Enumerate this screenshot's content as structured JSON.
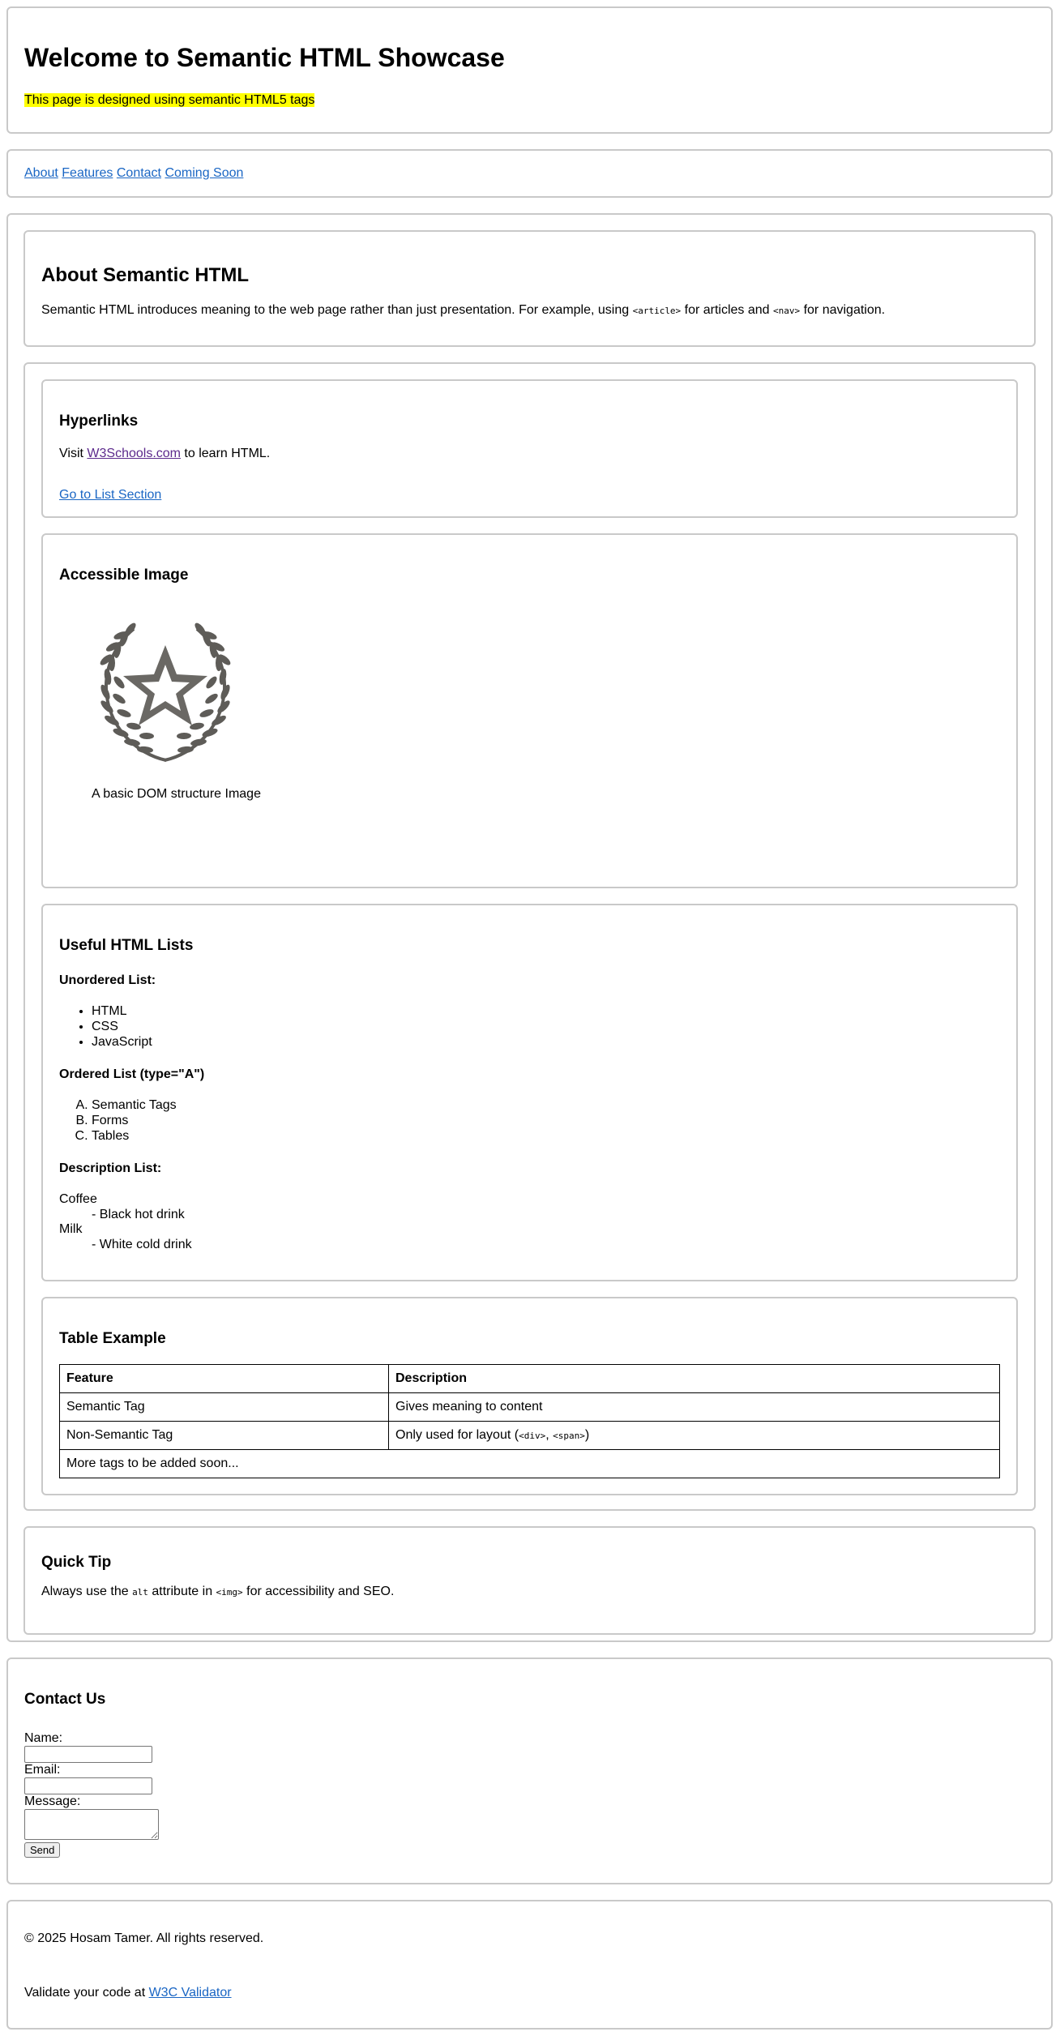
{
  "header": {
    "title": "Welcome to Semantic HTML Showcase",
    "tagline": "This page is designed using semantic HTML5 tags"
  },
  "nav": {
    "links": [
      "About",
      "Features",
      "Contact",
      "Coming Soon"
    ]
  },
  "about": {
    "heading": "About Semantic HTML",
    "text_1": "Semantic HTML introduces meaning to the web page rather than just presentation. For example, using ",
    "code_1": "<article>",
    "text_2": " for articles and ",
    "code_2": "<nav>",
    "text_3": " for navigation."
  },
  "hyperlinks": {
    "heading": "Hyperlinks",
    "visit_prefix": "Visit ",
    "link_text": "W3Schools.com",
    "visit_suffix": " to learn HTML.",
    "goto_text": "Go to List Section"
  },
  "image_section": {
    "heading": "Accessible Image",
    "icon": "laurel-star-icon",
    "caption": "A basic DOM structure Image"
  },
  "lists": {
    "heading": "Useful HTML Lists",
    "unordered_label": "Unordered List:",
    "unordered_items": [
      "HTML",
      "CSS",
      "JavaScript"
    ],
    "ordered_label": "Ordered List (type=\"A\")",
    "ordered_items": [
      "Semantic Tags",
      "Forms",
      "Tables"
    ],
    "description_label": "Description List:",
    "description_items": [
      {
        "term": "Coffee",
        "desc": "- Black hot drink"
      },
      {
        "term": "Milk",
        "desc": "- White cold drink"
      }
    ]
  },
  "table": {
    "heading": "Table Example",
    "columns": [
      "Feature",
      "Description"
    ],
    "rows": [
      [
        "Semantic Tag",
        "Gives meaning to content"
      ]
    ],
    "row2_feature": "Non-Semantic Tag",
    "row2_desc_prefix": "Only used for layout (",
    "row2_code_1": "<div>",
    "row2_sep": ", ",
    "row2_code_2": "<span>",
    "row2_desc_suffix": ")",
    "footer_row": "More tags to be added soon..."
  },
  "tip": {
    "heading": "Quick Tip",
    "text_1": "Always use the ",
    "code_1": "alt",
    "text_2": " attribute in ",
    "code_2": "<img>",
    "text_3": " for accessibility and SEO."
  },
  "contact": {
    "heading": "Contact Us",
    "name_label": "Name:",
    "email_label": "Email:",
    "message_label": "Message:",
    "name_value": "",
    "email_value": "",
    "message_value": "",
    "send_label": "Send"
  },
  "footer": {
    "copyright": "© 2025 Hosam Tamer. All rights reserved.",
    "validate_prefix": "Validate your code at ",
    "validate_link": "W3C Validator"
  },
  "colors": {
    "highlight": "#ffff00",
    "link": "#1a66c4",
    "visited_link": "#5c2a8c",
    "border": "#c9c9c9",
    "icon": "#666666"
  }
}
